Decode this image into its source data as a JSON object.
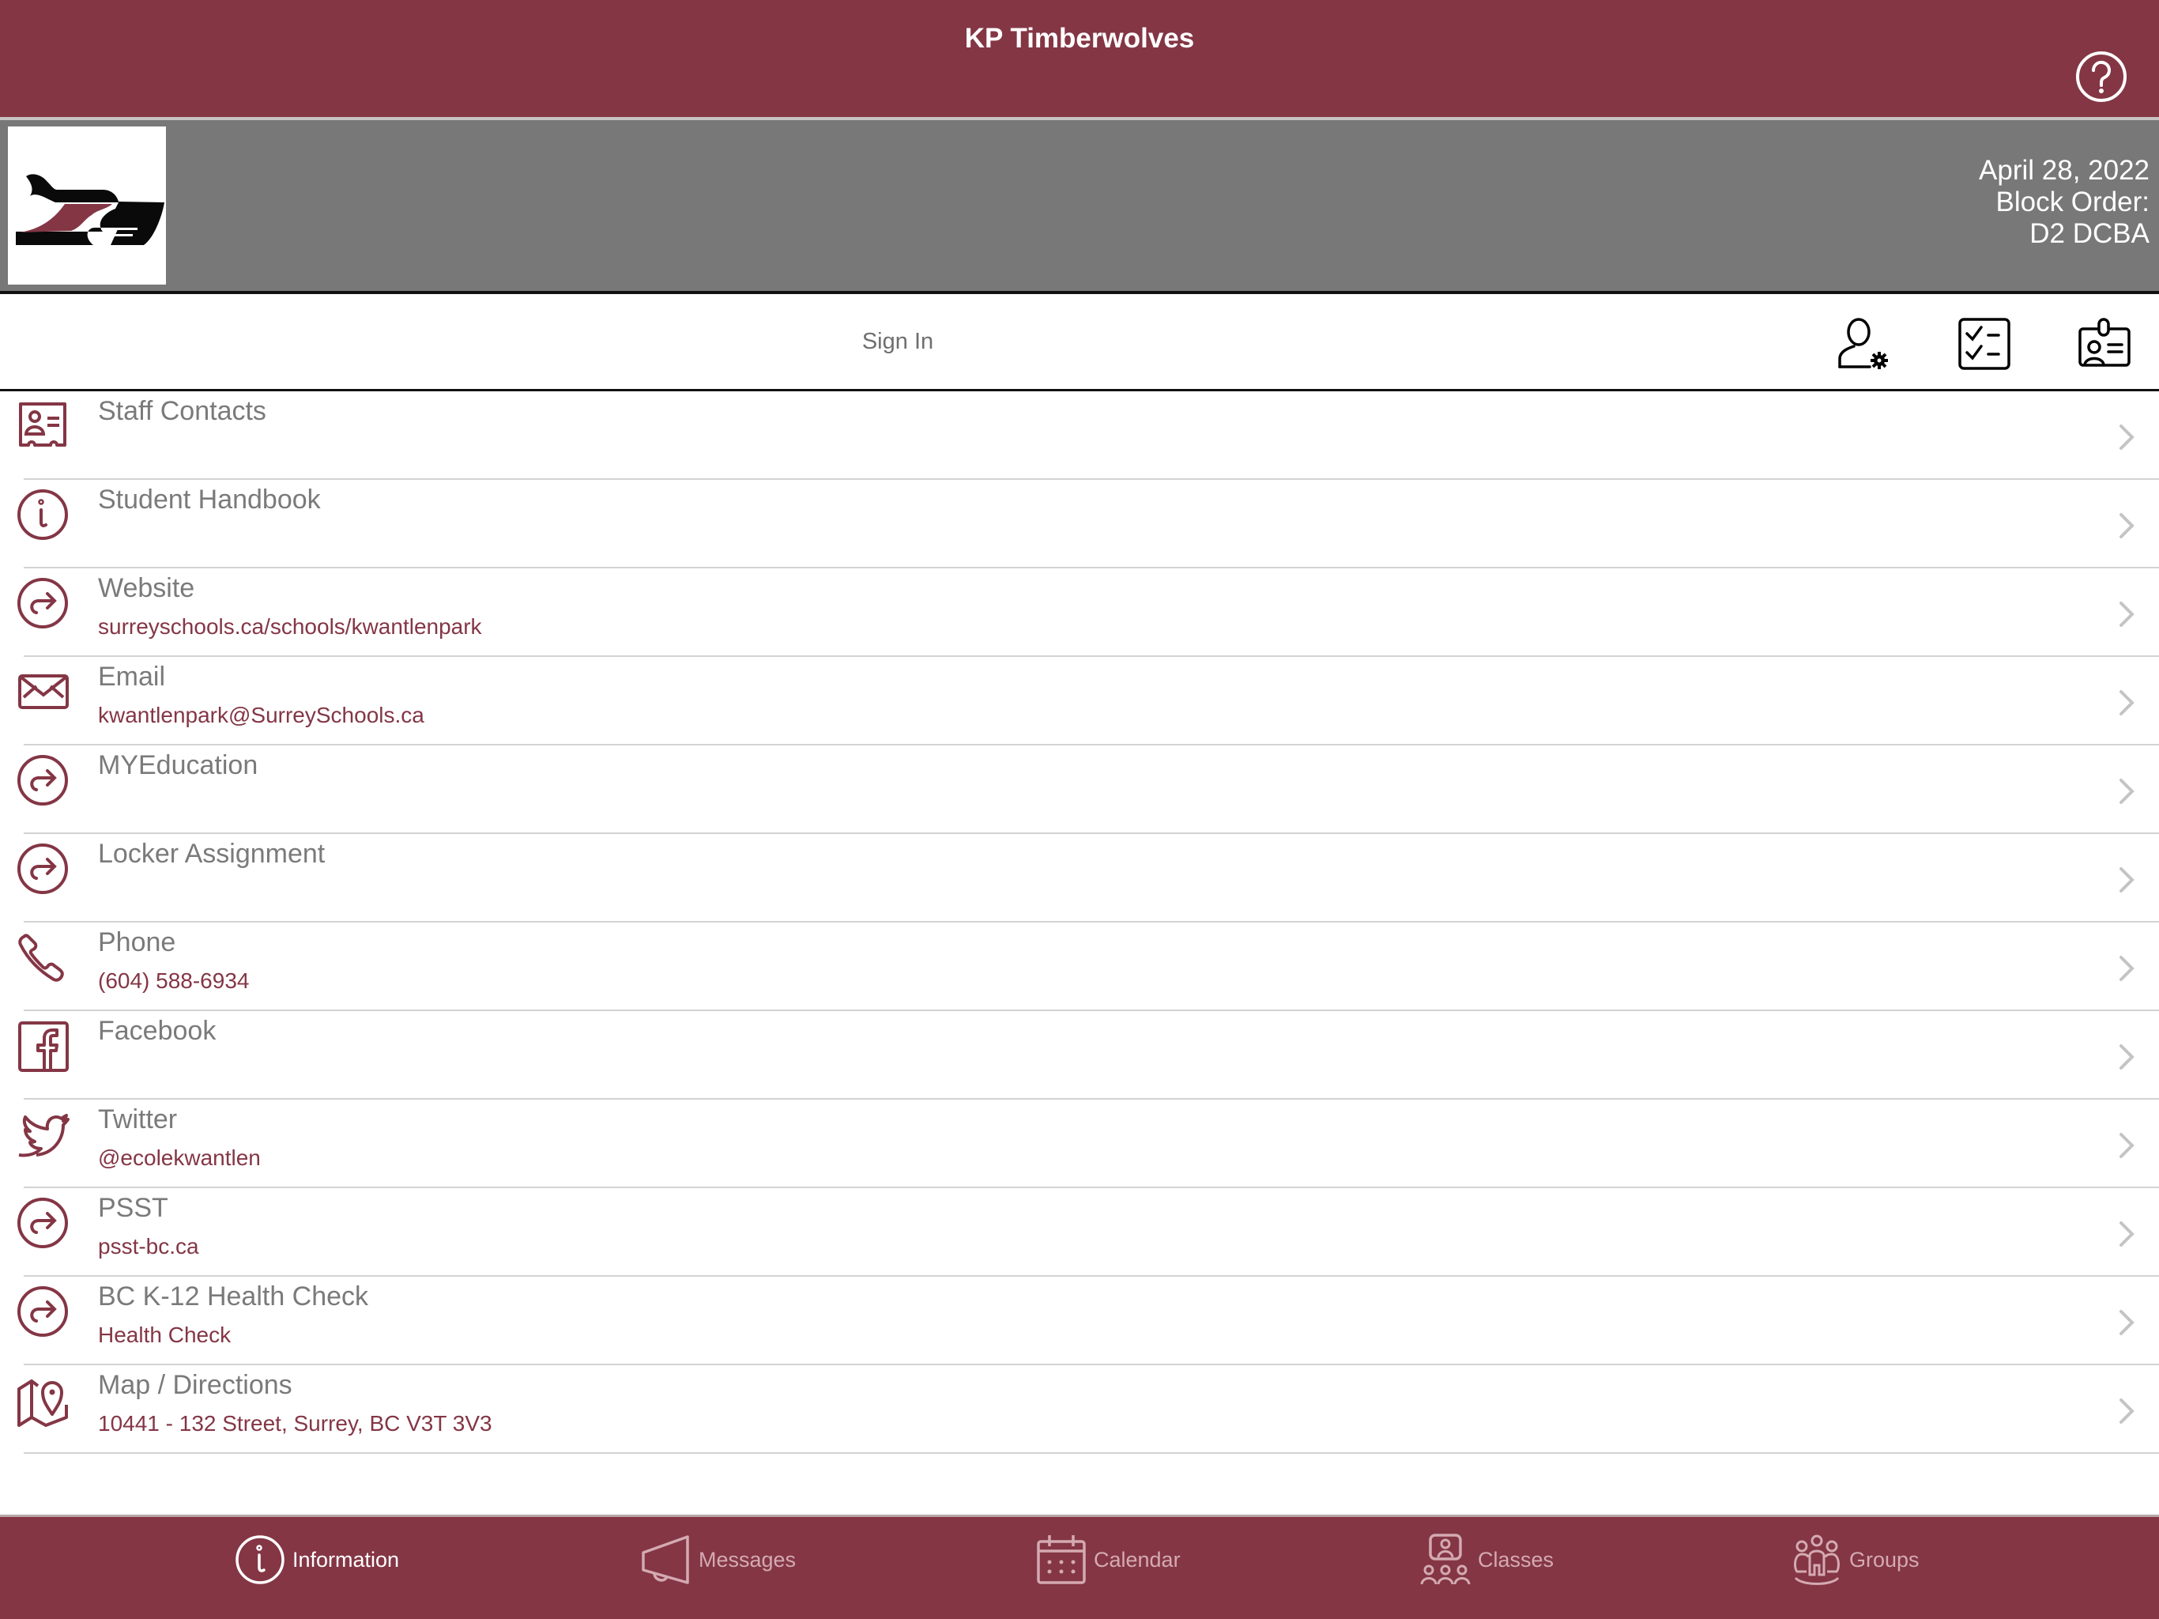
{
  "header": {
    "title": "KP Timberwolves",
    "help_icon": "question-circle-icon"
  },
  "banner": {
    "logo": "timberwolf-logo",
    "date": "April 28, 2022",
    "block_order_label": "Block Order:",
    "block_order_value": "D2 DCBA"
  },
  "action_bar": {
    "sign_in_label": "Sign In",
    "icons": [
      "user-settings-icon",
      "checklist-icon",
      "id-badge-icon"
    ]
  },
  "list": {
    "items": [
      {
        "title": "Staff Contacts",
        "subtitle": "",
        "icon": "contact-card-icon"
      },
      {
        "title": "Student Handbook",
        "subtitle": "",
        "icon": "info-circle-icon"
      },
      {
        "title": "Website",
        "subtitle": "surreyschools.ca/schools/kwantlenpark",
        "icon": "redirect-circle-icon"
      },
      {
        "title": "Email",
        "subtitle": "kwantlenpark@SurreySchools.ca",
        "icon": "envelope-icon"
      },
      {
        "title": "MYEducation",
        "subtitle": "",
        "icon": "redirect-circle-icon"
      },
      {
        "title": "Locker Assignment",
        "subtitle": "",
        "icon": "redirect-circle-icon"
      },
      {
        "title": "Phone",
        "subtitle": "(604) 588-6934",
        "icon": "phone-icon"
      },
      {
        "title": "Facebook",
        "subtitle": "",
        "icon": "facebook-icon"
      },
      {
        "title": "Twitter",
        "subtitle": "@ecolekwantlen",
        "icon": "twitter-icon"
      },
      {
        "title": "PSST",
        "subtitle": "psst-bc.ca",
        "icon": "redirect-circle-icon"
      },
      {
        "title": "BC K-12 Health Check",
        "subtitle": "Health Check",
        "icon": "redirect-circle-icon"
      },
      {
        "title": "Map / Directions",
        "subtitle": "10441 - 132 Street, Surrey, BC V3T 3V3",
        "icon": "map-pin-icon"
      }
    ]
  },
  "tabbar": {
    "tabs": [
      {
        "label": "Information",
        "icon": "info-circle-icon",
        "active": true
      },
      {
        "label": "Messages",
        "icon": "megaphone-icon",
        "active": false
      },
      {
        "label": "Calendar",
        "icon": "calendar-icon",
        "active": false
      },
      {
        "label": "Classes",
        "icon": "classroom-icon",
        "active": false
      },
      {
        "label": "Groups",
        "icon": "groups-icon",
        "active": false
      }
    ]
  },
  "colors": {
    "brand": "#843645",
    "band": "#787878",
    "title_text": "#7a7a7a",
    "subtitle_text": "#843645",
    "inactive_tab": "#d4aab1"
  }
}
